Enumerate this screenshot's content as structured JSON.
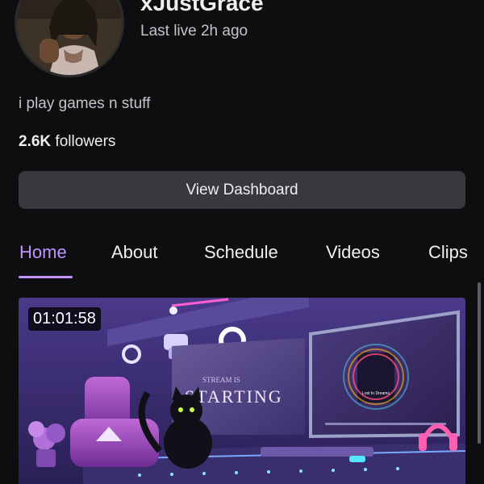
{
  "profile": {
    "channel_name": "xJustGrace",
    "last_live": "Last live 2h ago",
    "bio": "i play games n stuff",
    "followers_count": "2.6K",
    "followers_label": " followers"
  },
  "actions": {
    "dashboard_label": "View Dashboard"
  },
  "tabs": [
    {
      "label": "Home",
      "active": true
    },
    {
      "label": "About",
      "active": false
    },
    {
      "label": "Schedule",
      "active": false
    },
    {
      "label": "Videos",
      "active": false
    },
    {
      "label": "Clips",
      "active": false
    }
  ],
  "video": {
    "duration": "01:01:58",
    "screen_text_top": "STREAM IS",
    "screen_text_main": "STARTING",
    "player_caption": "Lost In Dreams"
  },
  "colors": {
    "accent": "#bf94ff",
    "background": "#0e0e10",
    "button": "#38383d"
  }
}
